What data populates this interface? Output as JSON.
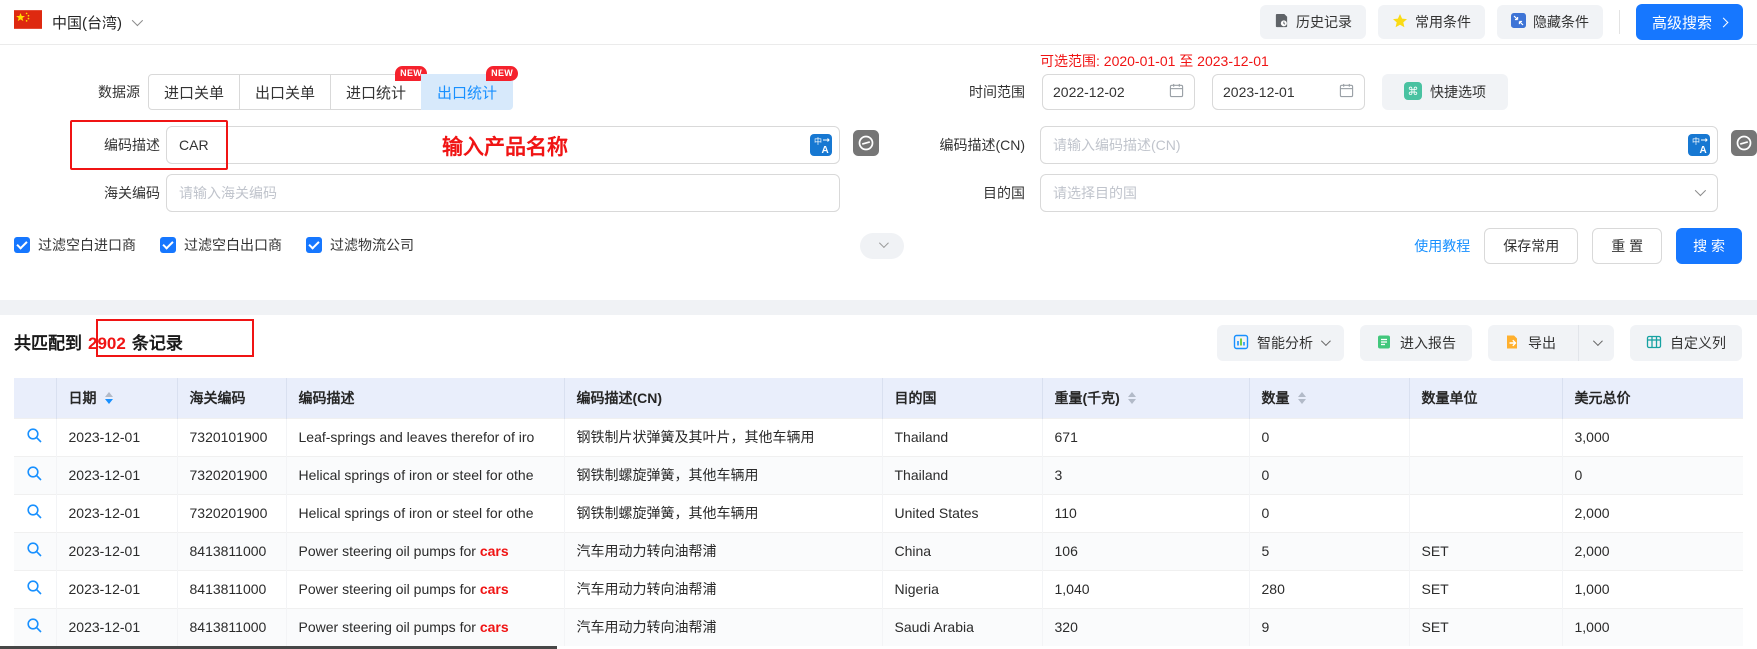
{
  "topbar": {
    "region": "中国(台湾)",
    "history_label": "历史记录",
    "favorites_label": "常用条件",
    "hide_label": "隐藏条件",
    "advanced_label": "高级搜索"
  },
  "filters": {
    "available_range": "可选范围: 2020-01-01 至 2023-12-01",
    "datasource_label": "数据源",
    "tabs": [
      {
        "label": "进口关单",
        "badge": ""
      },
      {
        "label": "出口关单",
        "badge": ""
      },
      {
        "label": "进口统计",
        "badge": "NEW"
      },
      {
        "label": "出口统计",
        "badge": "NEW"
      }
    ],
    "time_label": "时间范围",
    "date_start": "2022-12-02",
    "date_end": "2023-12-01",
    "quick_label": "快捷选项",
    "desc_label": "编码描述",
    "desc_value": "CAR",
    "desc_hint": "输入产品名称",
    "desc_cn_label": "编码描述(CN)",
    "desc_cn_placeholder": "请输入编码描述(CN)",
    "hs_label": "海关编码",
    "hs_placeholder": "请输入海关编码",
    "dest_label": "目的国",
    "dest_placeholder": "请选择目的国",
    "checkbox_import": "过滤空白进口商",
    "checkbox_export": "过滤空白出口商",
    "checkbox_logistics": "过滤物流公司",
    "tutorial_label": "使用教程",
    "save_label": "保存常用",
    "reset_label": "重 置",
    "search_label": "搜 索"
  },
  "results": {
    "summary_prefix": "共匹配到",
    "summary_count": "2902",
    "summary_suffix": "条记录",
    "analysis_label": "智能分析",
    "report_label": "进入报告",
    "export_label": "导出",
    "columns_label": "自定义列"
  },
  "table": {
    "headers": {
      "date": "日期",
      "hs_code": "海关编码",
      "desc": "编码描述",
      "desc_cn": "编码描述(CN)",
      "country": "目的国",
      "weight": "重量(千克)",
      "qty": "数量",
      "unit": "数量单位",
      "total": "美元总价"
    },
    "rows": [
      {
        "date": "2023-12-01",
        "hs": "7320101900",
        "desc": "Leaf-springs and leaves therefor of iro",
        "desc_hl": "",
        "desc_cn": "钢铁制片状弹簧及其叶片，其他车辆用",
        "country": "Thailand",
        "weight": "671",
        "qty": "0",
        "unit": "",
        "total": "3,000"
      },
      {
        "date": "2023-12-01",
        "hs": "7320201900",
        "desc": "Helical springs of iron or steel for othe",
        "desc_hl": "",
        "desc_cn": "钢铁制螺旋弹簧，其他车辆用",
        "country": "Thailand",
        "weight": "3",
        "qty": "0",
        "unit": "",
        "total": "0"
      },
      {
        "date": "2023-12-01",
        "hs": "7320201900",
        "desc": "Helical springs of iron or steel for othe",
        "desc_hl": "",
        "desc_cn": "钢铁制螺旋弹簧，其他车辆用",
        "country": "United States",
        "weight": "110",
        "qty": "0",
        "unit": "",
        "total": "2,000"
      },
      {
        "date": "2023-12-01",
        "hs": "8413811000",
        "desc": "Power steering oil pumps for ",
        "desc_hl": "cars",
        "desc_cn": "汽车用动力转向油帮浦",
        "country": "China",
        "weight": "106",
        "qty": "5",
        "unit": "SET",
        "total": "2,000"
      },
      {
        "date": "2023-12-01",
        "hs": "8413811000",
        "desc": "Power steering oil pumps for ",
        "desc_hl": "cars",
        "desc_cn": "汽车用动力转向油帮浦",
        "country": "Nigeria",
        "weight": "1,040",
        "qty": "280",
        "unit": "SET",
        "total": "1,000"
      },
      {
        "date": "2023-12-01",
        "hs": "8413811000",
        "desc": "Power steering oil pumps for ",
        "desc_hl": "cars",
        "desc_cn": "汽车用动力转向油帮浦",
        "country": "Saudi Arabia",
        "weight": "320",
        "qty": "9",
        "unit": "SET",
        "total": "1,000"
      }
    ]
  },
  "colors": {
    "primary": "#1677ff",
    "alert_red": "#f01414",
    "table_header_bg": "#e9eefb",
    "active_tab_bg": "#d7e9fb",
    "badge_red": "#f5222d"
  }
}
